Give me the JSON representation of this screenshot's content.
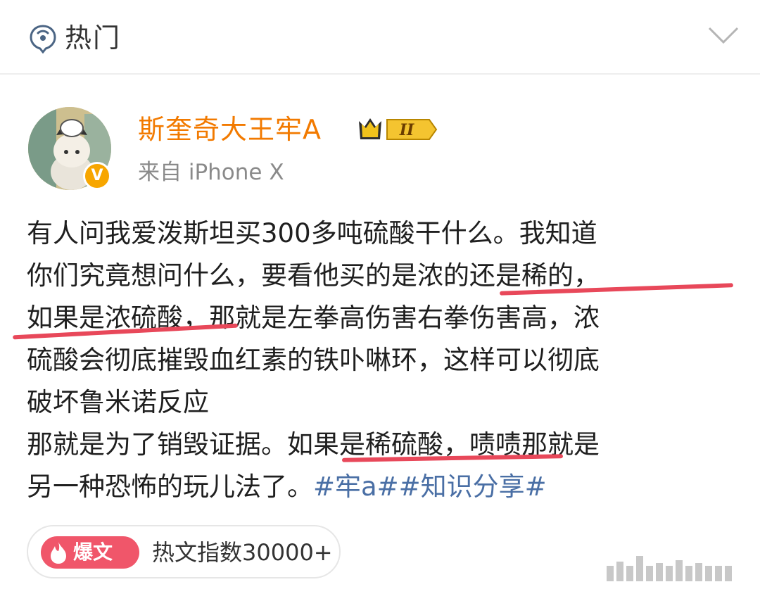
{
  "header": {
    "title": "热门",
    "icon": "hot-topic-icon",
    "collapse_icon": "chevron-down-icon"
  },
  "author": {
    "name": "斯奎奇大王牢A",
    "badge_text": "II",
    "badge_icon": "crown-icon",
    "verified_text": "V",
    "source": "来自 iPhone X"
  },
  "post": {
    "lines": [
      "有人问我爱泼斯坦买300多吨硫酸干什么。我知道",
      "你们究竟想问什么，要看他买的是浓的还是稀的，",
      "如果是浓硫酸，那就是左拳高伤害右拳伤害高，浓",
      "硫酸会彻底摧毁血红素的铁卟啉环，这样可以彻底",
      "破坏鲁米诺反应",
      "那就是为了销毁证据。如果是稀硫酸，啧啧那就是"
    ],
    "last_line_text": "另一种恐怖的玩儿法了。",
    "hashtags": "#牢a##知识分享#"
  },
  "hot": {
    "badge": "爆文",
    "index_text": "热文指数30000+"
  },
  "colors": {
    "username": "#f27a00",
    "hashtag": "#4a6fa5",
    "underline": "#e8485a",
    "hot_badge": "#f0566a"
  }
}
